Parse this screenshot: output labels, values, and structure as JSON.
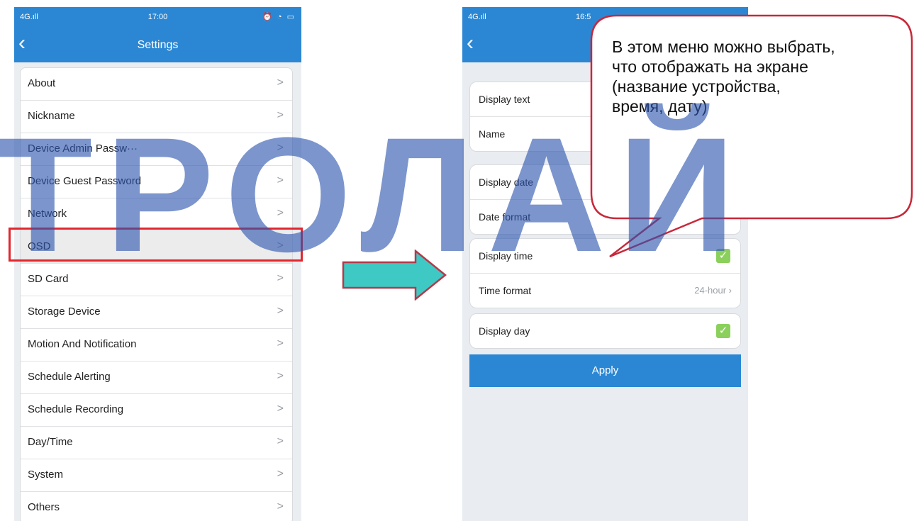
{
  "left_phone": {
    "status": {
      "signal": "4G.ıll",
      "time": "17:00",
      "icons": "⏰ ◔ ▭"
    },
    "nav": {
      "back": "‹",
      "title": "Settings"
    },
    "items": [
      {
        "label": "About"
      },
      {
        "label": "Nickname"
      },
      {
        "label": "Device Admin Passw···"
      },
      {
        "label": "Device Guest Password"
      },
      {
        "label": "Network"
      },
      {
        "label": "OSD"
      },
      {
        "label": "SD Card"
      },
      {
        "label": "Storage Device"
      },
      {
        "label": "Motion And Notification"
      },
      {
        "label": "Schedule Alerting"
      },
      {
        "label": "Schedule Recording"
      },
      {
        "label": "Day/Time"
      },
      {
        "label": "System"
      },
      {
        "label": "Others"
      }
    ],
    "chevron": ">"
  },
  "right_phone": {
    "status": {
      "signal": "4G.ıll",
      "time": "16:5"
    },
    "nav": {
      "back": "‹"
    },
    "group1": {
      "display_text": "Display text",
      "name": "Name"
    },
    "group2": {
      "display_date": "Display date",
      "date_format": "Date format"
    },
    "group3": {
      "display_time": "Display time",
      "time_format": "Time format",
      "time_format_value": "24-hour ›"
    },
    "group4": {
      "display_day": "Display day"
    },
    "checkmark": "✓",
    "apply": "Apply"
  },
  "callout": {
    "text": "В этом меню можно выбрать,\nчто отображать на экране\n(название устройства,\nвремя, дату)"
  },
  "watermark": {
    "text": "ТРОЛАЙ",
    "color": "#2c54ae"
  },
  "colors": {
    "accent": "#2b87d3",
    "highlight": "#e2262e",
    "arrow": "#3ec9c4",
    "checkbox": "#8bd05c"
  }
}
